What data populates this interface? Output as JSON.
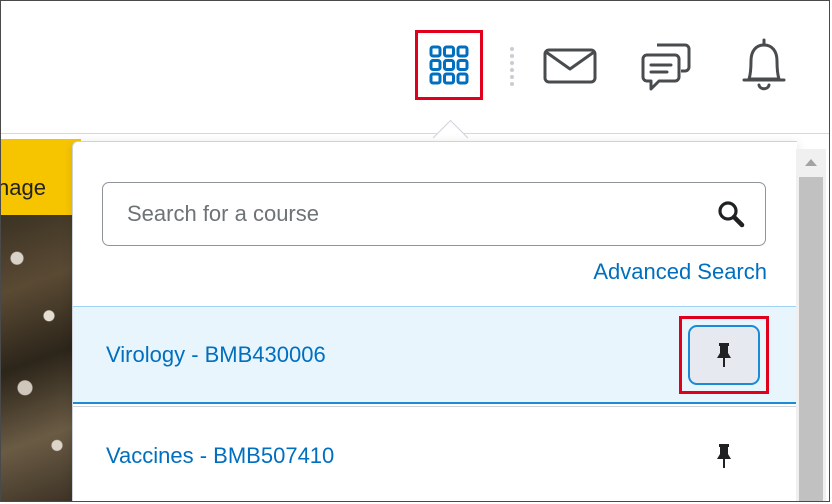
{
  "header": {
    "icons": {
      "waffle": "course-selector-waffle-icon",
      "mail": "envelope-icon",
      "chat": "chat-bubbles-icon",
      "bell": "bell-icon"
    }
  },
  "background": {
    "partial_text": "nage"
  },
  "course_selector": {
    "search": {
      "placeholder": "Search for a course",
      "value": ""
    },
    "advanced_search_label": "Advanced Search",
    "courses": [
      {
        "name": "Virology - BMB430006",
        "pinned": true
      },
      {
        "name": "Vaccines - BMB507410",
        "pinned": false
      }
    ]
  },
  "colors": {
    "accent": "#006fbf",
    "highlight_box": "#e0001b",
    "selected_row": "#e8f5fd",
    "banner": "#f7c500"
  }
}
